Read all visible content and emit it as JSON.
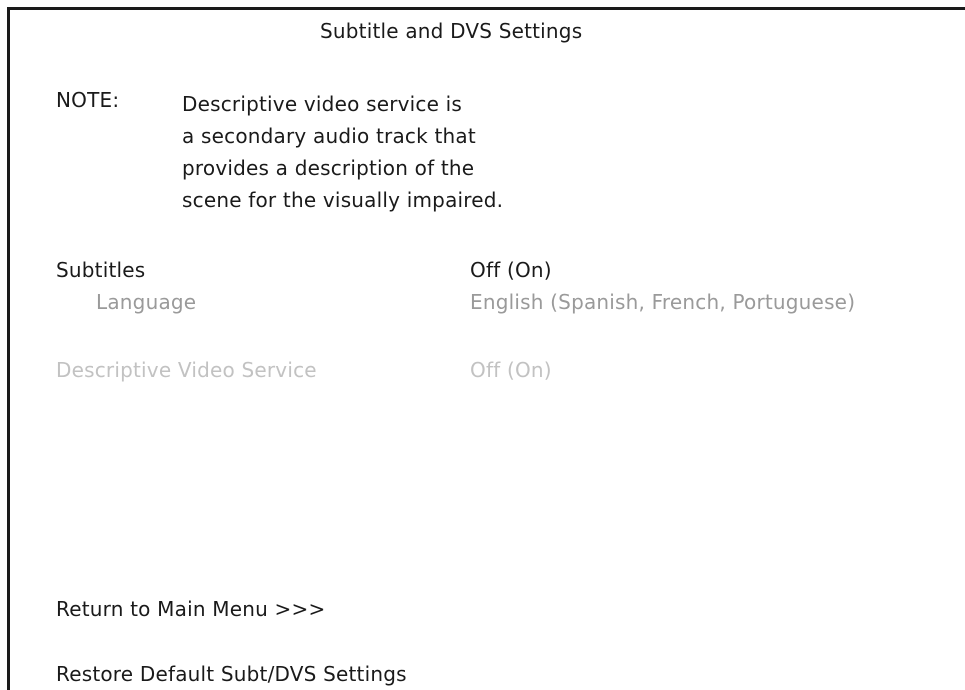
{
  "screen": {
    "title": "Subtitle and DVS Settings"
  },
  "note": {
    "label": "NOTE:",
    "lines": [
      "Descriptive video service is",
      "a secondary audio track that",
      "provides a description of the",
      "scene for the visually impaired."
    ]
  },
  "settings": {
    "subtitles": {
      "label": "Subtitles",
      "value": "Off (On)"
    },
    "language": {
      "label": "Language",
      "value": "English (Spanish, French, Portuguese)"
    },
    "dvs": {
      "label": "Descriptive Video Service",
      "value": "Off (On)"
    }
  },
  "actions": {
    "return_label": "Return to Main Menu >>>",
    "restore_label": "Restore Default Subt/DVS Settings"
  },
  "colors": {
    "text": "#1a1a1a",
    "dimmed": "#9a9a9a",
    "disabled": "#c2c2c2",
    "background": "#ffffff"
  }
}
